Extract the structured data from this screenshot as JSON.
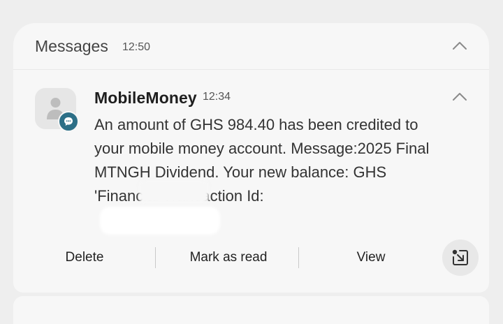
{
  "group": {
    "app_name": "Messages",
    "time": "12:50",
    "collapse_icon": "chevron-up-icon"
  },
  "notification": {
    "sender": "MobileMoney",
    "time": "12:34",
    "avatar_icon": "person-icon",
    "badge_icon": "message-bubble-icon",
    "badge_color": "#2c6f87",
    "body": "An amount of GHS 984.40 has been credited to your mobile money account. Message:2025 Final MTNGH Dividend. Your new balance: GHS       'Financial Transaction Id:",
    "collapse_icon": "chevron-up-icon"
  },
  "actions": {
    "delete": "Delete",
    "mark_as_read": "Mark as read",
    "view": "View",
    "expand_icon": "open-in-app-icon"
  }
}
